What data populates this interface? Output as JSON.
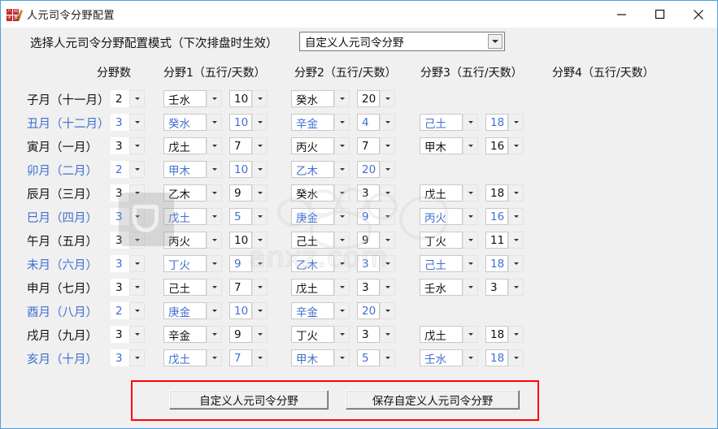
{
  "window": {
    "title": "人元司令分野配置",
    "icon_name": "bazi-seal-icon",
    "seal_chars": [
      "八",
      "字",
      "网",
      "盘"
    ],
    "controls": {
      "minimize": "minimize-icon",
      "maximize": "maximize-icon",
      "close": "close-icon"
    },
    "accent_color": "#4a9fe0"
  },
  "mode": {
    "label": "选择人元司令分野配置模式（下次排盘时生效）",
    "selected": "自定义人元司令分野"
  },
  "headers": {
    "count": "分野数",
    "p1": "分野1（五行/天数）",
    "p2": "分野2（五行/天数）",
    "p3": "分野3（五行/天数）",
    "p4": "分野4（五行/天数）"
  },
  "colors": {
    "black_row": "#111111",
    "blue_row": "#3f6fd1",
    "highlight_frame": "#ff0000"
  },
  "rows": [
    {
      "month": "子月（十一月）",
      "color": "black",
      "count": "2",
      "p1_name": "壬水",
      "p1_days": "10",
      "p2_name": "癸水",
      "p2_days": "20",
      "p3_name": "",
      "p3_days": "",
      "p4_name": "",
      "p4_days": ""
    },
    {
      "month": "丑月（十二月）",
      "color": "blue",
      "count": "3",
      "p1_name": "癸水",
      "p1_days": "10",
      "p2_name": "辛金",
      "p2_days": "4",
      "p3_name": "己土",
      "p3_days": "18",
      "p4_name": "",
      "p4_days": ""
    },
    {
      "month": "寅月（一月）",
      "color": "black",
      "count": "3",
      "p1_name": "戊土",
      "p1_days": "7",
      "p2_name": "丙火",
      "p2_days": "7",
      "p3_name": "甲木",
      "p3_days": "16",
      "p4_name": "",
      "p4_days": ""
    },
    {
      "month": "卯月（二月）",
      "color": "blue",
      "count": "2",
      "p1_name": "甲木",
      "p1_days": "10",
      "p2_name": "乙木",
      "p2_days": "20",
      "p3_name": "",
      "p3_days": "",
      "p4_name": "",
      "p4_days": ""
    },
    {
      "month": "辰月（三月）",
      "color": "black",
      "count": "3",
      "p1_name": "乙木",
      "p1_days": "9",
      "p2_name": "癸水",
      "p2_days": "3",
      "p3_name": "戊土",
      "p3_days": "18",
      "p4_name": "",
      "p4_days": ""
    },
    {
      "month": "巳月（四月）",
      "color": "blue",
      "count": "3",
      "p1_name": "戊土",
      "p1_days": "5",
      "p2_name": "庚金",
      "p2_days": "9",
      "p3_name": "丙火",
      "p3_days": "16",
      "p4_name": "",
      "p4_days": ""
    },
    {
      "month": "午月（五月）",
      "color": "black",
      "count": "3",
      "p1_name": "丙火",
      "p1_days": "10",
      "p2_name": "己土",
      "p2_days": "9",
      "p3_name": "丁火",
      "p3_days": "11",
      "p4_name": "",
      "p4_days": ""
    },
    {
      "month": "未月（六月）",
      "color": "blue",
      "count": "3",
      "p1_name": "丁火",
      "p1_days": "9",
      "p2_name": "乙木",
      "p2_days": "3",
      "p3_name": "己土",
      "p3_days": "18",
      "p4_name": "",
      "p4_days": ""
    },
    {
      "month": "申月（七月）",
      "color": "black",
      "count": "3",
      "p1_name": "己土",
      "p1_days": "7",
      "p2_name": "戊土",
      "p2_days": "3",
      "p3_name": "壬水",
      "p3_days": "3",
      "p4_name": "",
      "p4_days": ""
    },
    {
      "month": "酉月（八月）",
      "color": "blue",
      "count": "2",
      "p1_name": "庚金",
      "p1_days": "10",
      "p2_name": "辛金",
      "p2_days": "20",
      "p3_name": "",
      "p3_days": "",
      "p4_name": "",
      "p4_days": ""
    },
    {
      "month": "戌月（九月）",
      "color": "black",
      "count": "3",
      "p1_name": "辛金",
      "p1_days": "9",
      "p2_name": "丁火",
      "p2_days": "3",
      "p3_name": "戊土",
      "p3_days": "18",
      "p4_name": "",
      "p4_days": ""
    },
    {
      "month": "亥月（十月）",
      "color": "blue",
      "count": "3",
      "p1_name": "戊土",
      "p1_days": "7",
      "p2_name": "甲木",
      "p2_days": "5",
      "p3_name": "壬水",
      "p3_days": "18",
      "p4_name": "",
      "p4_days": ""
    }
  ],
  "actions": {
    "custom": "自定义人元司令分野",
    "save": "保存自定义人元司令分野"
  },
  "watermark": {
    "text": "anxz.com"
  }
}
